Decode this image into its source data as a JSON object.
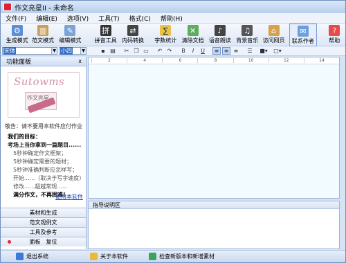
{
  "window": {
    "title": "作文亮星II - 未命名"
  },
  "menu": [
    "文件(F)",
    "编辑(E)",
    "选项(V)",
    "工具(T)",
    "格式(C)",
    "帮助(H)"
  ],
  "toolbar": [
    {
      "label": "生成模式",
      "icon": "gear-icon"
    },
    {
      "label": "范文模式",
      "icon": "books-icon"
    },
    {
      "label": "编辑模式",
      "icon": "pencil-icon"
    },
    {
      "label": "拼音工具",
      "icon": "pinyin-icon"
    },
    {
      "label": "内码转换",
      "icon": "convert-icon"
    },
    {
      "label": "字数统计",
      "icon": "count-icon"
    },
    {
      "label": "清除文档",
      "icon": "clear-icon"
    },
    {
      "label": "语音朗读",
      "icon": "speaker-icon"
    },
    {
      "label": "背景音乐",
      "icon": "music-icon"
    },
    {
      "label": "访问网页",
      "icon": "home-icon"
    },
    {
      "label": "联系作者",
      "icon": "contact-icon"
    },
    {
      "label": "帮助",
      "icon": "help-icon"
    }
  ],
  "format": {
    "font": "宋体",
    "size": "小四"
  },
  "side_panel": {
    "title": "功能面板",
    "pin": "x",
    "logo_script": "Sutowms",
    "logo_book": "作文亮星",
    "notice": "敬告：请不要用本软件应付作业",
    "goals": {
      "heading": "我们的目标：",
      "line1": "考场上当你拿到一篇题目......",
      "items": [
        "5秒钟确定作文框架；",
        "5秒钟确定需要的题材；",
        "5秒钟准确判断应怎样写；",
        "开始......（取决于写字速度）",
        "修改......超越常规......"
      ],
      "last": "满分作文，不再困难！"
    },
    "use_link": "使用本软件",
    "nav": [
      "素材和生成",
      "范文观例文",
      "工具及参考",
      "面板　复位"
    ]
  },
  "ruler": [
    "2",
    "4",
    "6",
    "8",
    "10",
    "12",
    "14"
  ],
  "hint": {
    "title": "指导说明区"
  },
  "status": [
    "退出系统",
    "关于本软件",
    "检查新版本和新增素材"
  ]
}
